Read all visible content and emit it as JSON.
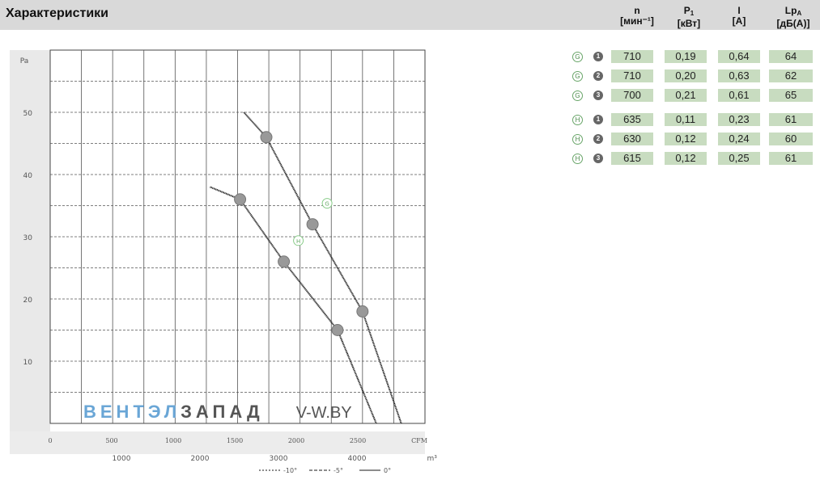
{
  "header": {
    "title": "Характеристики",
    "columns": [
      {
        "symbol": "n",
        "sub": "",
        "unit": "[мин⁻¹]"
      },
      {
        "symbol": "P",
        "sub": "1",
        "unit": "[кВт]"
      },
      {
        "symbol": "I",
        "sub": "",
        "unit": "[А]"
      },
      {
        "symbol": "Lp",
        "sub": "A",
        "unit": "[дБ(А)]"
      }
    ]
  },
  "table": {
    "rows": [
      {
        "curve": "G",
        "point": "1",
        "values": [
          "710",
          "0,19",
          "0,64",
          "64"
        ]
      },
      {
        "curve": "G",
        "point": "2",
        "values": [
          "710",
          "0,20",
          "0,63",
          "62"
        ]
      },
      {
        "curve": "G",
        "point": "3",
        "values": [
          "700",
          "0,21",
          "0,61",
          "65"
        ]
      },
      {
        "curve": "H",
        "point": "1",
        "values": [
          "635",
          "0,11",
          "0,23",
          "61"
        ]
      },
      {
        "curve": "H",
        "point": "2",
        "values": [
          "630",
          "0,12",
          "0,24",
          "60"
        ]
      },
      {
        "curve": "H",
        "point": "3",
        "values": [
          "615",
          "0,12",
          "0,25",
          "61"
        ]
      }
    ]
  },
  "watermark": {
    "part1": "ВЕНТЭЛ",
    "part2": "ЗАПАД",
    "part3": "V-W.BY"
  },
  "colors": {
    "header_bg": "#d9d9d9",
    "cell_bg": "#c8dcc0",
    "grid": "#333333",
    "curve": "#222222",
    "marker": "#999999",
    "accent": "#6aa6d6"
  },
  "chart_data": {
    "type": "line",
    "x": {
      "ticks": [
        "0",
        "500",
        "1000",
        "1500",
        "2000",
        "2500",
        "CFM"
      ],
      "ticks_m3h": [
        "1000",
        "2000",
        "3000",
        "4000",
        "m³/h"
      ],
      "range": [
        0,
        2500
      ]
    },
    "y": {
      "ticks": [
        "10",
        "20",
        "30",
        "40",
        "50"
      ],
      "left_label": "Pa",
      "range": [
        0,
        60
      ]
    },
    "series": [
      {
        "name": "G",
        "points": [
          [
            1550,
            50
          ],
          [
            1730,
            46
          ],
          [
            2100,
            32
          ],
          [
            2500,
            18
          ],
          [
            2810,
            0
          ]
        ],
        "markers": [
          "1",
          "2",
          "3"
        ]
      },
      {
        "name": "H",
        "points": [
          [
            1280,
            38
          ],
          [
            1520,
            36
          ],
          [
            1870,
            26
          ],
          [
            2300,
            15
          ],
          [
            2610,
            0
          ]
        ],
        "markers": [
          "1",
          "2",
          "3"
        ]
      }
    ],
    "grid": true,
    "footer_legend": [
      "-10°",
      "-5°",
      "0°"
    ]
  }
}
